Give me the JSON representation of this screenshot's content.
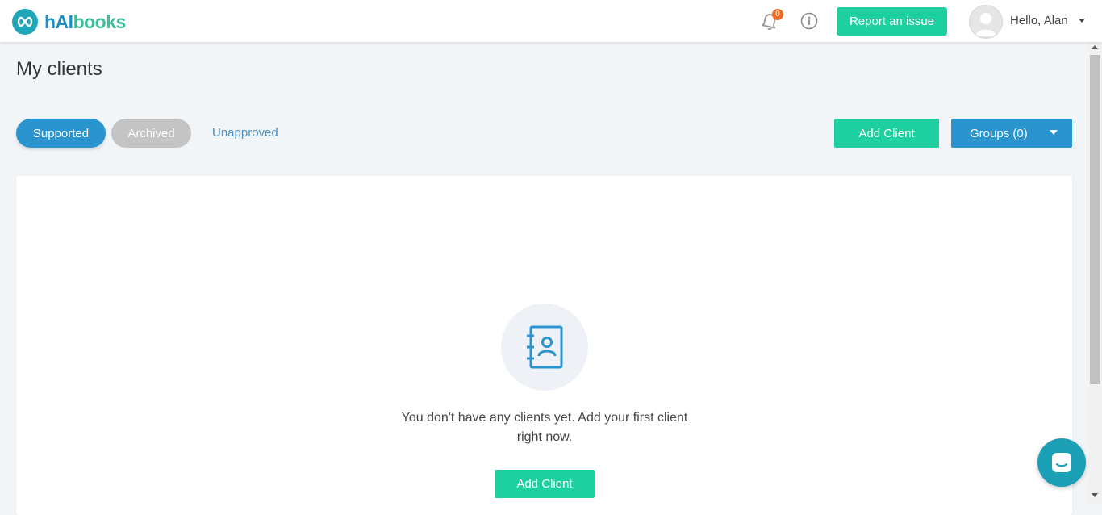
{
  "header": {
    "logo": {
      "part1": "hAI",
      "part2": "books"
    },
    "notifications_count": "0",
    "report_label": "Report an issue",
    "user_greeting": "Hello, Alan"
  },
  "page": {
    "title": "My clients",
    "tabs": [
      {
        "label": "Supported",
        "active": true
      },
      {
        "label": "Archived",
        "active": false
      },
      {
        "label": "Unapproved",
        "active": false
      }
    ],
    "add_client_label": "Add Client",
    "groups_label": "Groups (0)"
  },
  "empty_state": {
    "icon": "contact-book-icon",
    "message": "You don't have any clients yet. Add your first client right now.",
    "button_label": "Add Client"
  },
  "colors": {
    "brand_green": "#1ecfa0",
    "brand_blue": "#2a94cf",
    "notification_badge": "#ef6b1f",
    "chat_bubble": "#1a9fb4"
  }
}
